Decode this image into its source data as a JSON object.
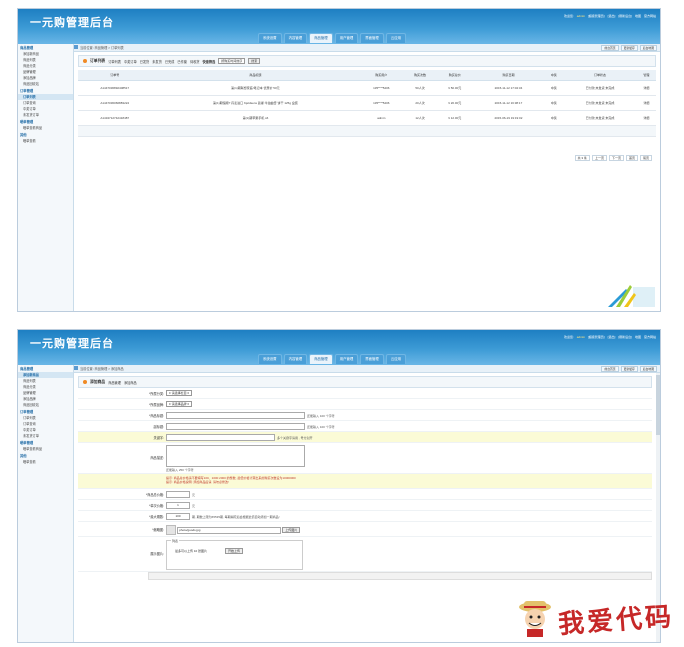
{
  "app": {
    "logo": "一元购管理后台",
    "user_links": [
      "欢迎您:",
      "admin",
      "[超级管理员]",
      "[退出]",
      "[刷新后台]",
      "地图",
      "官方网站"
    ],
    "nav_tabs": [
      "系统设置",
      "内容管理",
      "商品管理",
      "用户管理",
      "界面管理",
      "云应用"
    ],
    "active_tab": "商品管理",
    "quick_buttons": [
      "前台首页",
      "更新缓存",
      "后台地图"
    ]
  },
  "sidebar": {
    "groups": [
      {
        "title": "商品管理",
        "items": [
          "添加新商品",
          "商品列表",
          "商品分类",
          "品牌管理",
          "添加品牌",
          "商品回收站"
        ]
      },
      {
        "title": "订单管理",
        "items": [
          "订单列表",
          "订单查询",
          "中奖订单",
          "未发货订单"
        ]
      },
      {
        "title": "晒单管理",
        "items": [
          "晒单查看商品"
        ]
      },
      {
        "title": "其他",
        "items": [
          "晒单查看"
        ]
      }
    ]
  },
  "screen1": {
    "breadcrumb": "当前位置: 商品管理 > 订单列表",
    "active_side_item": "订单列表",
    "toolbar": {
      "title": "订单列表",
      "links": [
        "订单列表",
        "中奖订单",
        "已发货",
        "未发货",
        "已完成",
        "已作废",
        "待收货",
        "快速筛选"
      ],
      "select_value": "按购买时间倒序",
      "button": "搜索"
    },
    "columns": [
      "订单号",
      "商品标题",
      "购买用户",
      "购买次数",
      "购买总价",
      "购买日期",
      "中奖",
      "订单状态",
      "管理"
    ],
    "rows": [
      [
        "A1447036892408517",
        "第(1)期联想家庭/笔记本 优惠价 50元",
        "135****5206",
        "50人次",
        "¥ 50.00元",
        "2015-11-12 17:04:34",
        "中奖",
        "已付款,未发货,未完成",
        "详细"
      ],
      [
        "A1447036066883224",
        "第(1)期恒顺?  丹麦进口 Kjeldsens 蓝罐 牛油曲奇 饼干 125g 盒装",
        "135****5206",
        "20人次",
        "¥ 20.00元",
        "2015-11-12 16:38:17",
        "中奖",
        "已付款,未发货,未完成",
        "详细"
      ],
      [
        "A1434712742418487",
        "第(1)期苹果手机 s6",
        "admin",
        "12人次",
        "¥ 12.00元",
        "2015-06-19 19:19:02",
        "中奖",
        "已付款,未发货,未完成",
        "详细"
      ]
    ],
    "pager": [
      "共 3 条",
      "上一页",
      "下一页",
      "首页",
      "尾页"
    ]
  },
  "screen2": {
    "breadcrumb": "当前位置: 商品管理 > 添加商品",
    "active_side_item": "添加新商品",
    "toolbar": {
      "title": "添加商品",
      "links": [
        "商品管理",
        "添加商品"
      ]
    },
    "form": {
      "category_label": "*所属分类:",
      "category_value": "≡ 请选择栏目 ≡",
      "brand_label": "*所属品牌:",
      "brand_value": "≡ 请选择品牌 ≡",
      "title_label": "*商品标题:",
      "title_hint": "还能输入 100 个字符",
      "subtitle_label": "副标题:",
      "subtitle_hint": "还能输入 100 个字符",
      "keyword_label": "关键字:",
      "keyword_hint": "多个关键字请用 , 号分割开",
      "desc_label": "商品描述:",
      "desc_hint": "还能输入 250 个字符",
      "note1": "提示: 商品总价格请不要填写100、1000 2000 的整数, 最低价格计算出来的购买次数设为10000000",
      "note2": "提示: 商品价格说明: 添加商品后请, 请勿必修改!",
      "price_label": "*商品总价格:",
      "price_value": "",
      "price_unit": "元",
      "single_label": "*单次价格:",
      "single_value": "1",
      "single_unit": "元",
      "max_label": "*最大期数:",
      "max_value": "100",
      "max_hint": "期, 期数上限为65535期, 每期揭晓后会根据此值自动添加一期商品!",
      "thumb_label": "*缩略图:",
      "thumb_value": "photo/goods.jpg",
      "thumb_button": "上传图片",
      "album_label": "展示图片:",
      "album_legend": "列表",
      "album_hint": "最多可以上传 10 张图片",
      "album_button": "开始上传"
    }
  },
  "watermark": {
    "text": "我爱代码"
  }
}
